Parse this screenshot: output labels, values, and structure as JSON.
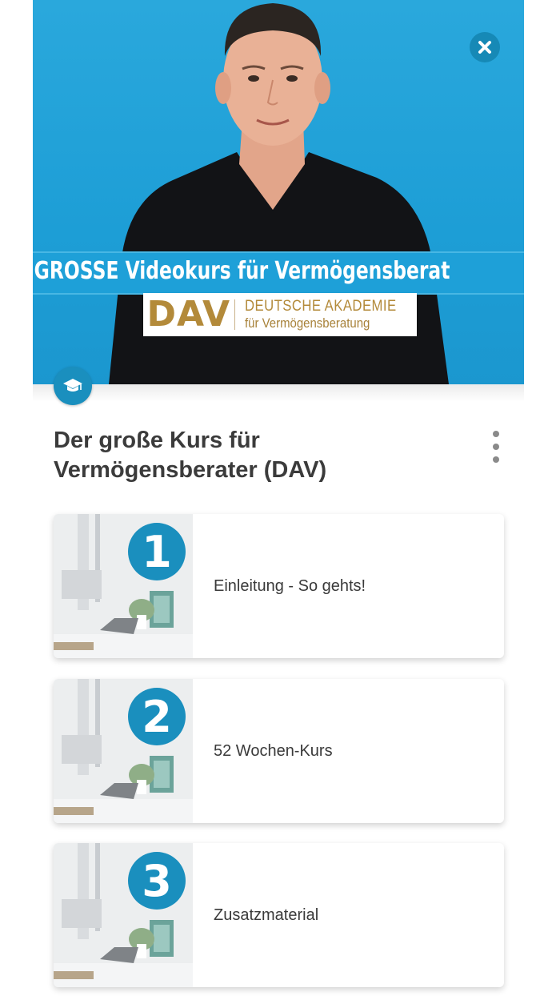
{
  "hero": {
    "banner_text": "r GROSSE Videokurs für Vermögensberat",
    "logo_mark": "DAV",
    "logo_line1": "DEUTSCHE AKADEMIE",
    "logo_line2": "für Vermögensberatung",
    "close_icon": "close-icon",
    "badge_icon": "graduation-cap-icon"
  },
  "course": {
    "title": "Der große Kurs für Vermögensberater (DAV)",
    "more_icon": "more-vertical-icon"
  },
  "modules": [
    {
      "number": "1",
      "label": "Einleitung - So gehts!"
    },
    {
      "number": "2",
      "label": "52 Wochen-Kurs"
    },
    {
      "number": "3",
      "label": "Zusatzmaterial"
    }
  ],
  "colors": {
    "accent": "#1a8fbe",
    "hero_bg": "#1d9ed6",
    "logo_gold": "#b38a3a"
  }
}
